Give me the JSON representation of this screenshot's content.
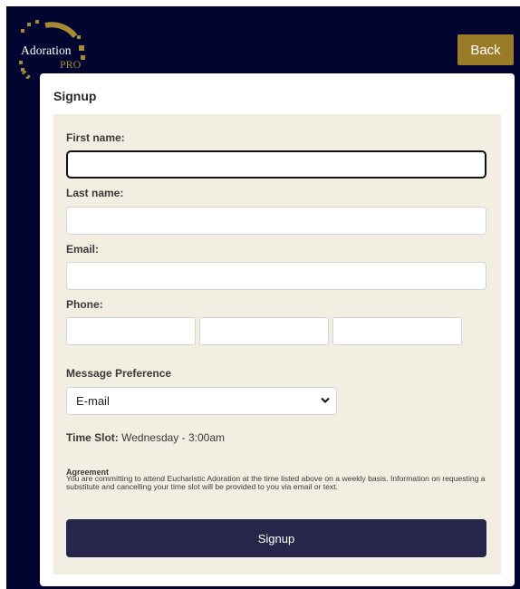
{
  "header": {
    "logo_text": "Adoration",
    "logo_sub": "PRO",
    "back_label": "Back"
  },
  "card": {
    "title": "Signup"
  },
  "form": {
    "first_name_label": "First name:",
    "first_name_value": "",
    "last_name_label": "Last name:",
    "last_name_value": "",
    "email_label": "Email:",
    "email_value": "",
    "phone_label": "Phone:",
    "phone_values": [
      "",
      "",
      ""
    ],
    "message_pref_label": "Message Preference",
    "message_pref_selected": "E-mail",
    "time_slot_label": "Time Slot:",
    "time_slot_value": "Wednesday - 3:00am",
    "agreement_title": "Agreement",
    "agreement_text": "You are committing to attend Eucharistic Adoration at the time listed above on a weekly basis. Information on requesting a substitute and cancelling your time slot will be provided to you via email or text.",
    "submit_label": "Signup"
  },
  "colors": {
    "page_background": "#020530",
    "back_button": "#9a7b28",
    "panel_background": "#f2eee2",
    "submit_button": "#27264a",
    "logo_ring": "#a88a32"
  },
  "icons": {
    "select_arrow": "chevron-down-icon",
    "logo_ring": "logo-ring-icon"
  }
}
